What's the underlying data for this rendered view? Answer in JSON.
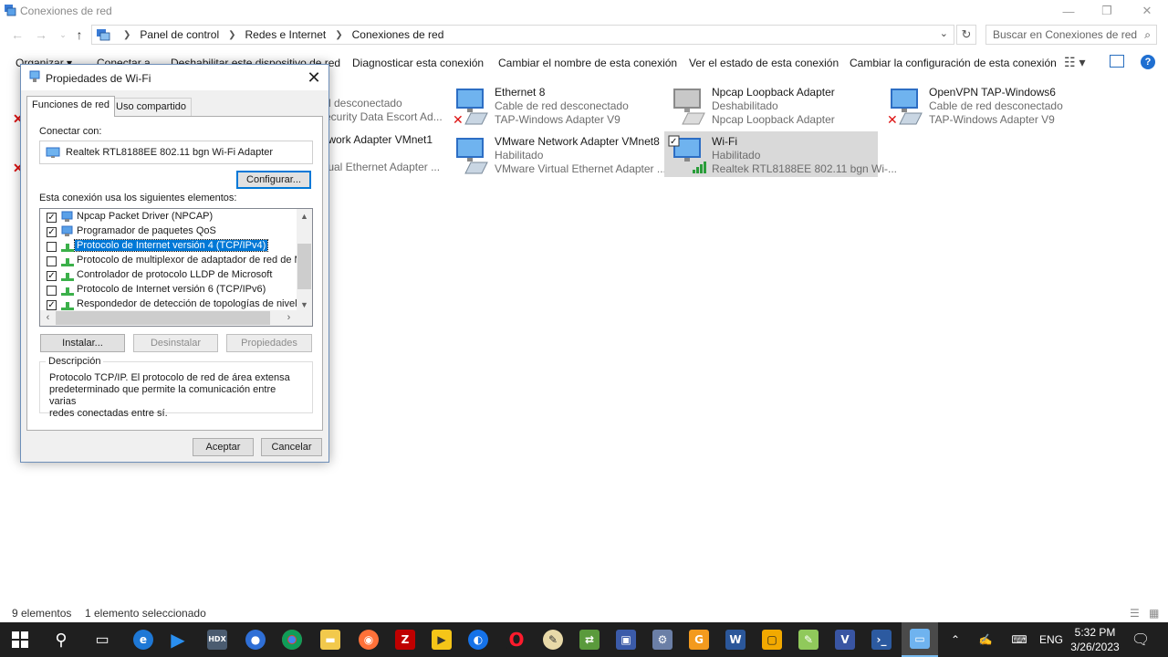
{
  "window": {
    "title": "Conexiones de red"
  },
  "address": {
    "crumbs": [
      "Panel de control",
      "Redes e Internet",
      "Conexiones de red"
    ],
    "search_placeholder": "Buscar en Conexiones de red"
  },
  "toolbar": {
    "organize": "Organizar ▾",
    "connect": "Conectar a",
    "disable": "Deshabilitar este dispositivo de red",
    "diagnose": "Diagnosticar esta conexión",
    "rename": "Cambiar el nombre de esta conexión",
    "view_status": "Ver el estado de esta conexión",
    "change_settings": "Cambiar la configuración de esta conexión"
  },
  "adapters": [
    {
      "name": "",
      "status": "d desconectado",
      "device": "ecurity Data Escort Ad..."
    },
    {
      "name": "Ethernet 8",
      "status": "Cable de red desconectado",
      "device": "TAP-Windows Adapter V9"
    },
    {
      "name": "Npcap Loopback Adapter",
      "status": "Deshabilitado",
      "device": "Npcap Loopback Adapter"
    },
    {
      "name": "OpenVPN TAP-Windows6",
      "status": "Cable de red desconectado",
      "device": "TAP-Windows Adapter V9"
    },
    {
      "name": "twork Adapter VMnet1",
      "status": "",
      "device": "tual Ethernet Adapter ..."
    },
    {
      "name": "VMware Network Adapter VMnet8",
      "status": "Habilitado",
      "device": "VMware Virtual Ethernet Adapter ..."
    },
    {
      "name": "Wi-Fi",
      "status": "Habilitado",
      "device": "Realtek RTL8188EE 802.11 bgn Wi-..."
    }
  ],
  "statusbar": {
    "count": "9 elementos",
    "selected": "1 elemento seleccionado"
  },
  "dialog": {
    "title": "Propiedades de Wi-Fi",
    "tabs": [
      "Funciones de red",
      "Uso compartido"
    ],
    "connect_with_label": "Conectar con:",
    "adapter_name": "Realtek RTL8188EE 802.11 bgn Wi-Fi Adapter",
    "configure": "Configurar...",
    "items_label": "Esta conexión usa los siguientes elementos:",
    "items": [
      {
        "label": "Npcap Packet Driver (NPCAP)",
        "checked": true
      },
      {
        "label": "Programador de paquetes QoS",
        "checked": true
      },
      {
        "label": "Protocolo de Internet versión 4 (TCP/IPv4)",
        "checked": false
      },
      {
        "label": "Protocolo de multiplexor de adaptador de red de Micros",
        "checked": false
      },
      {
        "label": "Controlador de protocolo LLDP de Microsoft",
        "checked": true
      },
      {
        "label": "Protocolo de Internet versión 6 (TCP/IPv6)",
        "checked": false
      },
      {
        "label": "Respondedor de detección de topologías de nivel de v",
        "checked": true
      }
    ],
    "install": "Instalar...",
    "uninstall": "Desinstalar",
    "properties": "Propiedades",
    "description_legend": "Descripción",
    "description": "Protocolo TCP/IP. El protocolo de red de área extensa\npredeterminado que permite la comunicación entre varias\nredes conectadas entre sí.",
    "ok": "Aceptar",
    "cancel": "Cancelar"
  },
  "taskbar": {
    "language": "ENG",
    "time": "5:32 PM",
    "date": "3/26/2023"
  }
}
